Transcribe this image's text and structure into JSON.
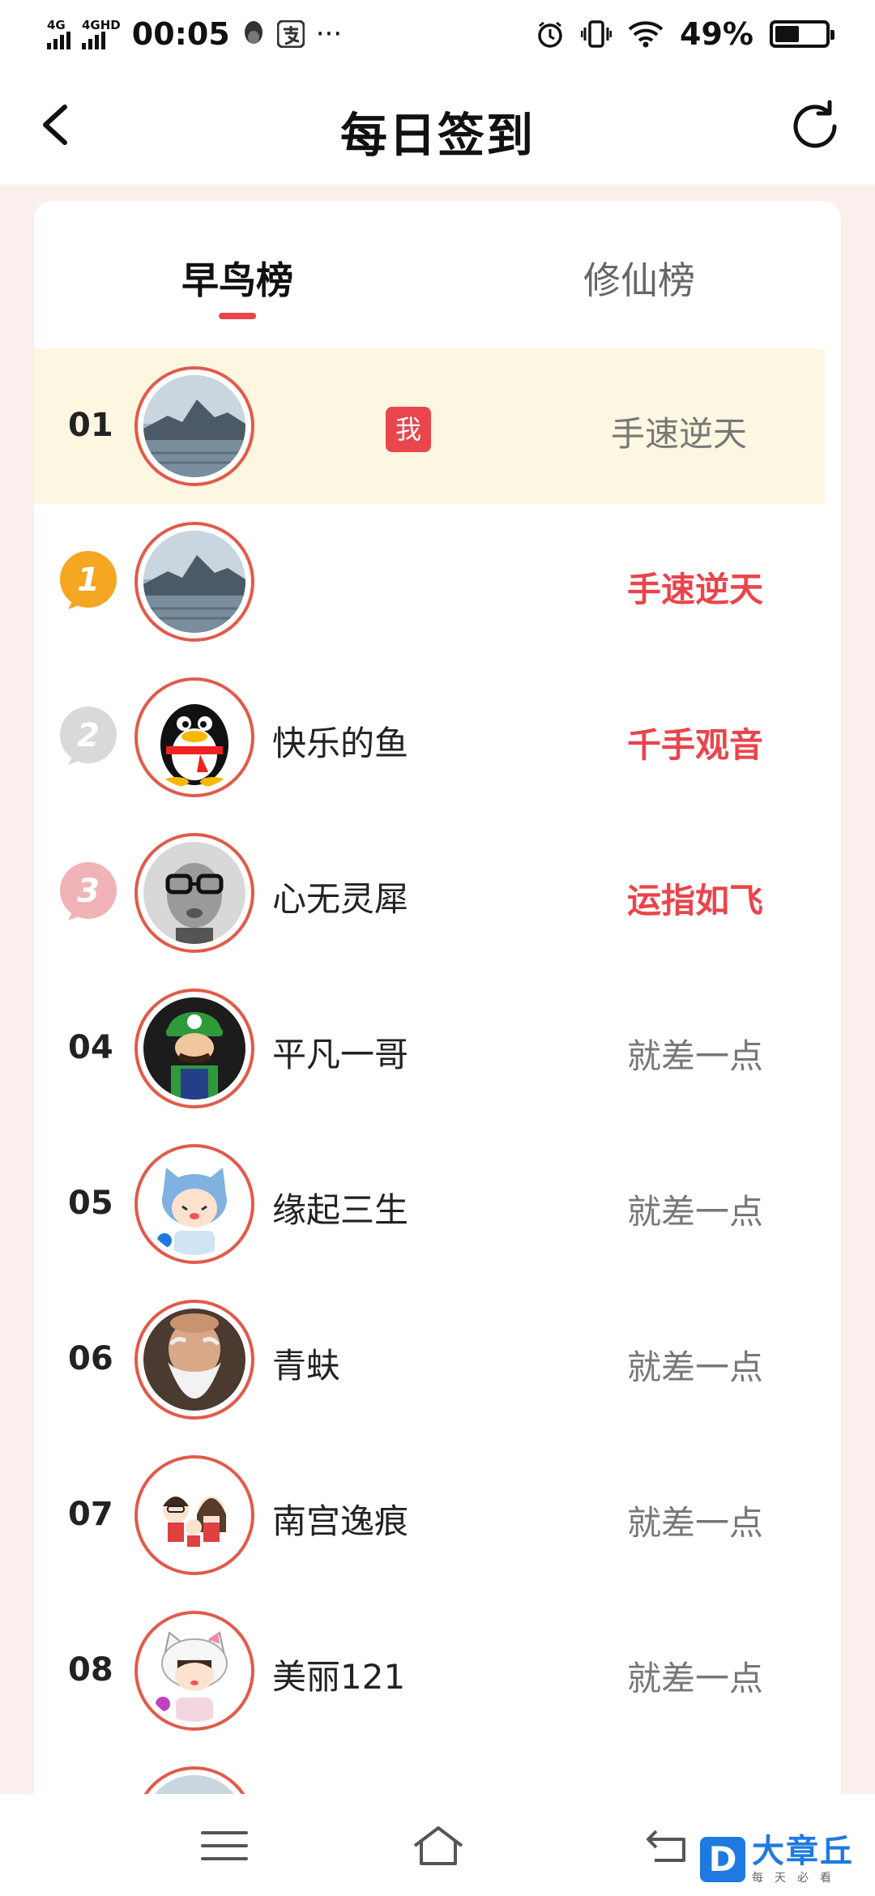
{
  "status_bar": {
    "network1": "4G",
    "network2": "4GHD",
    "time": "00:05",
    "more": "···",
    "battery_percent_text": "49%",
    "battery_level": 0.49
  },
  "nav": {
    "title": "每日签到"
  },
  "tabs": [
    {
      "label": "早鸟榜",
      "active": true
    },
    {
      "label": "修仙榜",
      "active": false
    }
  ],
  "me_badge": "我",
  "rows": [
    {
      "rank": "01",
      "name": "",
      "title": "手速逆天",
      "is_me": true
    },
    {
      "rank": "",
      "medal": "1",
      "name": "",
      "title": "手速逆天"
    },
    {
      "rank": "",
      "medal": "2",
      "name": "快乐的鱼",
      "title": "千手观音"
    },
    {
      "rank": "",
      "medal": "3",
      "name": "心无灵犀",
      "title": "运指如飞"
    },
    {
      "rank": "04",
      "name": "平凡一哥",
      "title": "就差一点"
    },
    {
      "rank": "05",
      "name": "缘起三生",
      "title": "就差一点"
    },
    {
      "rank": "06",
      "name": "青蚨",
      "title": "就差一点"
    },
    {
      "rank": "07",
      "name": "南宫逸痕",
      "title": "就差一点"
    },
    {
      "rank": "08",
      "name": "美丽121",
      "title": "就差一点"
    }
  ],
  "watermark": {
    "letter": "D",
    "brand": "大章丘",
    "slogan": "每天必看"
  },
  "colors": {
    "accent": "#e9454c",
    "avatar_ring": "#e25a4a",
    "highlight_row": "#fdf6e0",
    "page_bg": "#fdeeee",
    "medal_gold": "#f5a623",
    "medal_silver": "#d9d9d9",
    "medal_bronze": "#f0b3b8"
  }
}
